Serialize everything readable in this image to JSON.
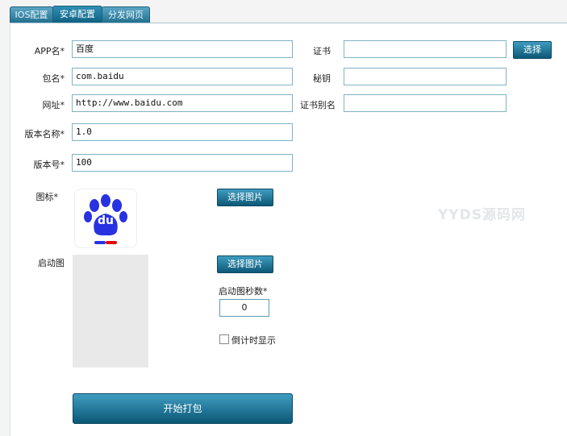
{
  "tabs": [
    {
      "label": "IOS配置"
    },
    {
      "label": "安卓配置"
    },
    {
      "label": "分发网页"
    }
  ],
  "active_tab": "安卓配置",
  "form": {
    "app_name": {
      "label": "APP名*",
      "value": "百度"
    },
    "package": {
      "label": "包名*",
      "value": "com.baidu"
    },
    "url": {
      "label": "网址*",
      "value": "http://www.baidu.com"
    },
    "version_name": {
      "label": "版本名称*",
      "value": "1.0"
    },
    "version_code": {
      "label": "版本号*",
      "value": "100"
    },
    "icon": {
      "label": "图标*",
      "button": "选择图片",
      "text": "du"
    },
    "splash": {
      "label": "启动图",
      "button": "选择图片"
    },
    "splash_seconds": {
      "label": "启动图秒数*",
      "value": "0"
    },
    "countdown": {
      "label": "倒计时显示",
      "checked": false
    }
  },
  "cert": {
    "label": "证书",
    "value": "",
    "button": "选择",
    "secret_label": "秘钥",
    "secret_value": "",
    "alias_label": "证书别名",
    "alias_value": ""
  },
  "start_button": "开始打包",
  "watermark": "YYDS源码网",
  "colors": {
    "accent": "#0c5876",
    "border": "#7fb3c6",
    "baidu_blue": "#2932e1",
    "baidu_red": "#e10602"
  }
}
